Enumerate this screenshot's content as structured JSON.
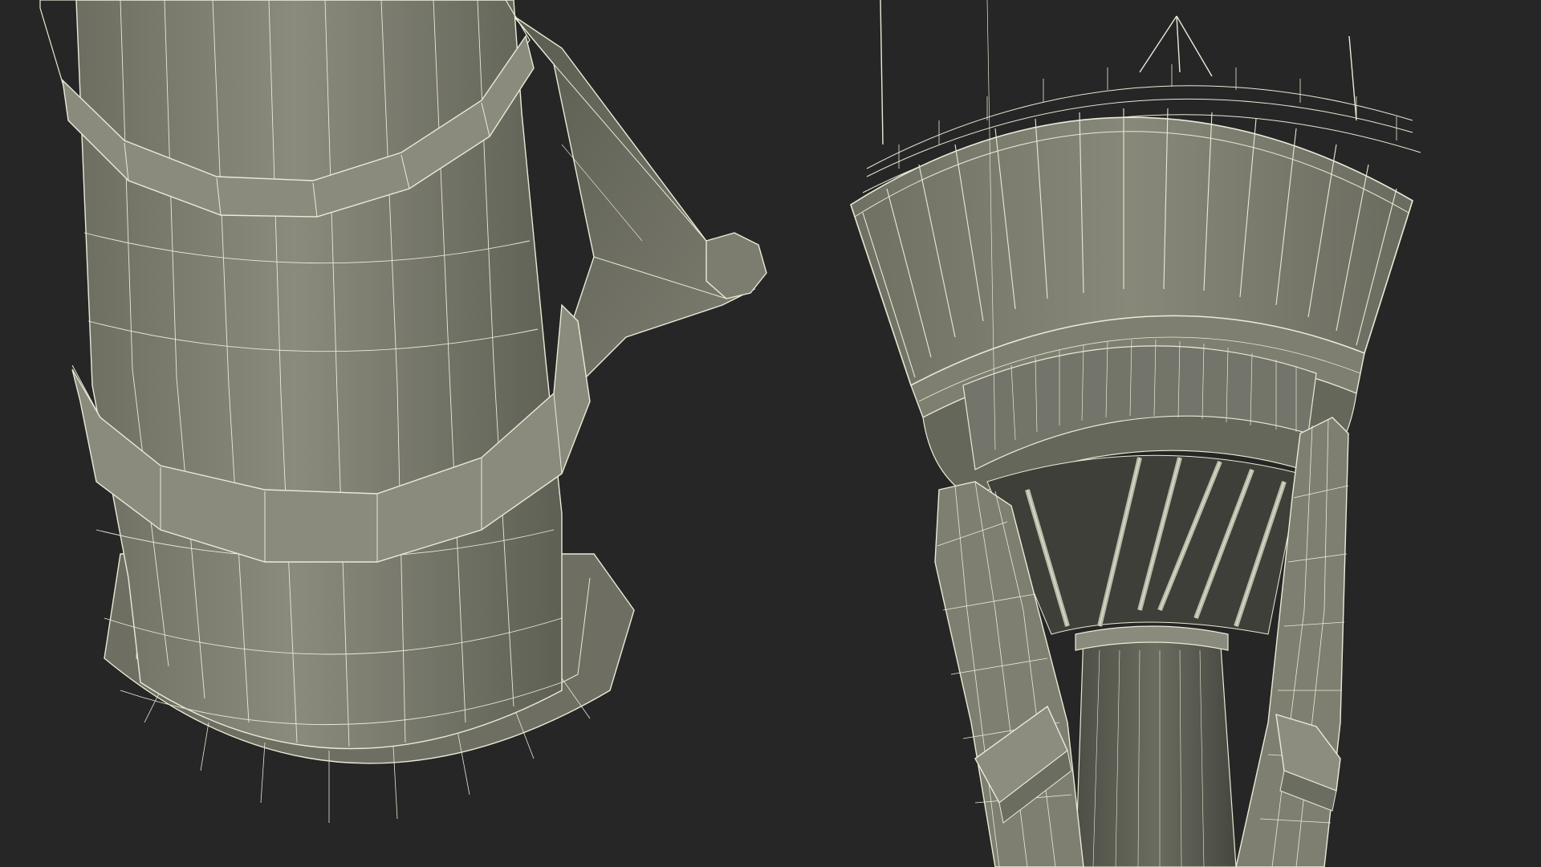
{
  "scene": {
    "colors": {
      "background": "#262626",
      "mesh_fill": "#7c7d6f",
      "mesh_fill_light": "#8b8c7e",
      "mesh_fill_dark": "#5e5f54",
      "wire": "#e9ead6"
    },
    "views": [
      {
        "name": "tower-base-closeup",
        "subject": "wireframe-tower-shaft"
      },
      {
        "name": "tower-cab-closeup",
        "subject": "wireframe-control-tower-cab"
      }
    ]
  }
}
